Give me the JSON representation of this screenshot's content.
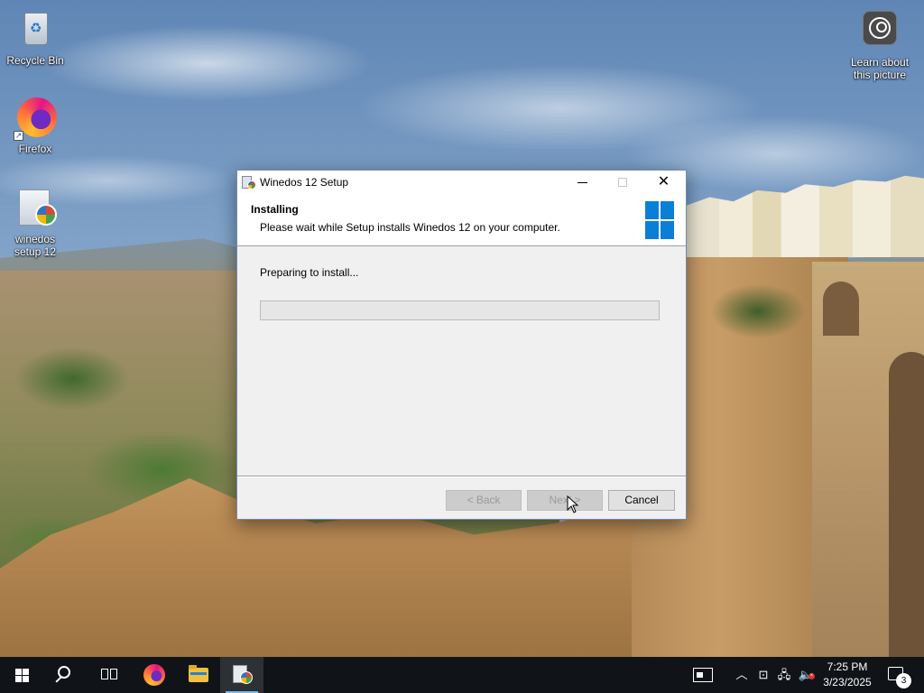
{
  "desktop": {
    "icons": [
      {
        "label": "Recycle Bin",
        "icon": "recycle-bin-icon"
      },
      {
        "label": "Firefox",
        "icon": "firefox-icon"
      },
      {
        "label": "winedos setup 12",
        "icon": "setup-icon"
      },
      {
        "label": "Learn about this picture",
        "icon": "learn-about-picture-icon"
      }
    ]
  },
  "window": {
    "title": "Winedos 12  Setup",
    "header_title": "Installing",
    "header_subtitle": "Please wait while Setup installs Winedos 12  on your computer.",
    "status": "Preparing to install...",
    "progress_percent": 0,
    "progress_color": "#06b025",
    "buttons": {
      "back": "< Back",
      "next": "Next >",
      "cancel": "Cancel"
    },
    "logo_color": "#0a7fd8"
  },
  "taskbar": {
    "pinned": [
      "start-button",
      "search-button",
      "task-view-button",
      "firefox",
      "file-explorer",
      "winedos-setup"
    ],
    "clock_time": "7:25 PM",
    "clock_date": "3/23/2025",
    "notification_count": "3",
    "background": "#101418"
  }
}
